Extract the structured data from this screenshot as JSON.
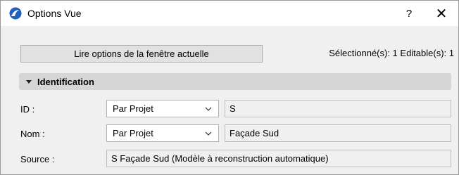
{
  "window": {
    "title": "Options Vue",
    "help_label": "?",
    "close_label": "✕"
  },
  "toolbar": {
    "read_button_label": "Lire options de la fenêtre actuelle",
    "selection_info": "Sélectionné(s): 1 Editable(s): 1"
  },
  "section": {
    "title": "Identification"
  },
  "rows": {
    "id": {
      "label": "ID :",
      "combo_value": "Par Projet",
      "field_value": "S"
    },
    "nom": {
      "label": "Nom :",
      "combo_value": "Par Projet",
      "field_value": "Façade Sud"
    },
    "source": {
      "label": "Source :",
      "field_value": "S Façade Sud (Modèle à reconstruction automatique)"
    }
  },
  "colors": {
    "app_icon_blue": "#1f5fbf",
    "section_bg": "#d6d6d6",
    "window_bg": "#f0f0f0"
  },
  "icons": {
    "app": "archicad-logo-icon",
    "expand": "triangle-down-icon",
    "dropdown": "chevron-down-icon"
  }
}
